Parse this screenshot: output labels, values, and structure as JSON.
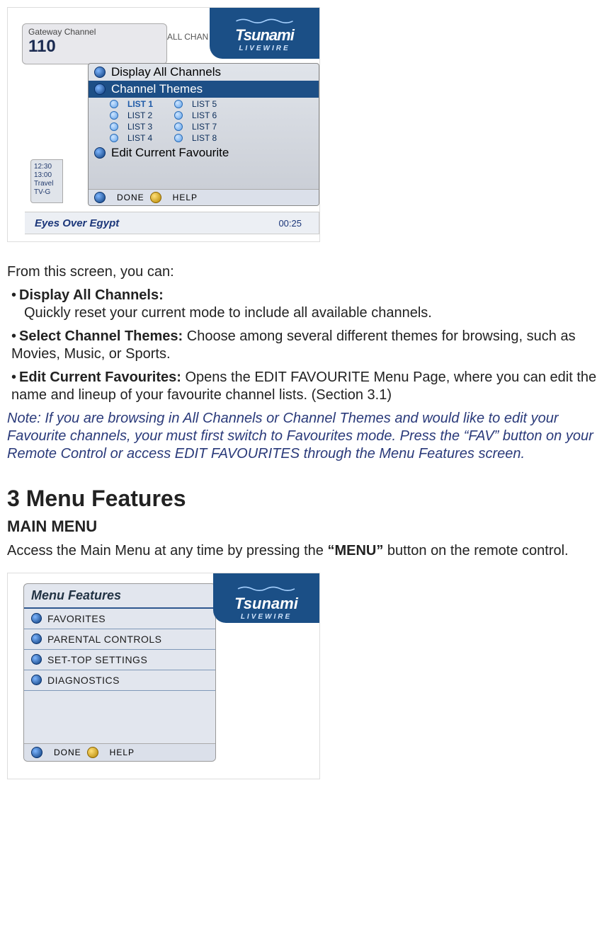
{
  "brand": {
    "name": "Tsunami",
    "sub": "LIVEWIRE"
  },
  "shot1": {
    "gateway_label": "Gateway Channel",
    "channel_num": "110",
    "allchan": "ALL CHAN",
    "menu": {
      "display_all": "Display All Channels",
      "channel_themes": "Channel Themes",
      "lists_col1": [
        "LIST 1",
        "LIST 2",
        "LIST 3",
        "LIST 4"
      ],
      "lists_col2": [
        "LIST 5",
        "LIST 6",
        "LIST 7",
        "LIST 8"
      ],
      "edit_fav": "Edit Current Favourite",
      "done": "DONE",
      "help": "HELP"
    },
    "side": {
      "t1": "12:30",
      "t2": "13:00",
      "t3": "Travel",
      "t4": "TV-G"
    },
    "bottom": {
      "title": "Eyes Over Egypt",
      "time": "00:25"
    }
  },
  "text": {
    "intro": "From this screen, you can:",
    "b1_title": "Display All Channels:",
    "b1_desc": "Quickly reset your current mode to include all available channels.",
    "b2_title": "Select Channel Themes:",
    "b2_desc": " Choose among several different themes for browsing, such as Movies, Music, or Sports.",
    "b3_title": "Edit Current Favourites:",
    "b3_desc": " Opens the EDIT FAVOURITE Menu Page, where you can edit the name and lineup of your favourite channel lists. (Section 3.1)",
    "note": "Note: If you are browsing in All Channels or Channel Themes and would like to edit your Favourite channels, your must first switch to Favourites mode. Press the “FAV” button on your Remote Control or access EDIT FAVOURITES through the Menu Features screen.",
    "h1": "3 Menu Features",
    "h2": "MAIN MENU",
    "mm1": "Access the Main Menu at any time by pressing the ",
    "mm_bold": "“MENU”",
    "mm2": " button on the remote control."
  },
  "shot2": {
    "title": "Menu Features",
    "items": [
      "FAVORITES",
      "PARENTAL CONTROLS",
      "SET-TOP SETTINGS",
      "DIAGNOSTICS"
    ],
    "done": "DONE",
    "help": "HELP"
  }
}
